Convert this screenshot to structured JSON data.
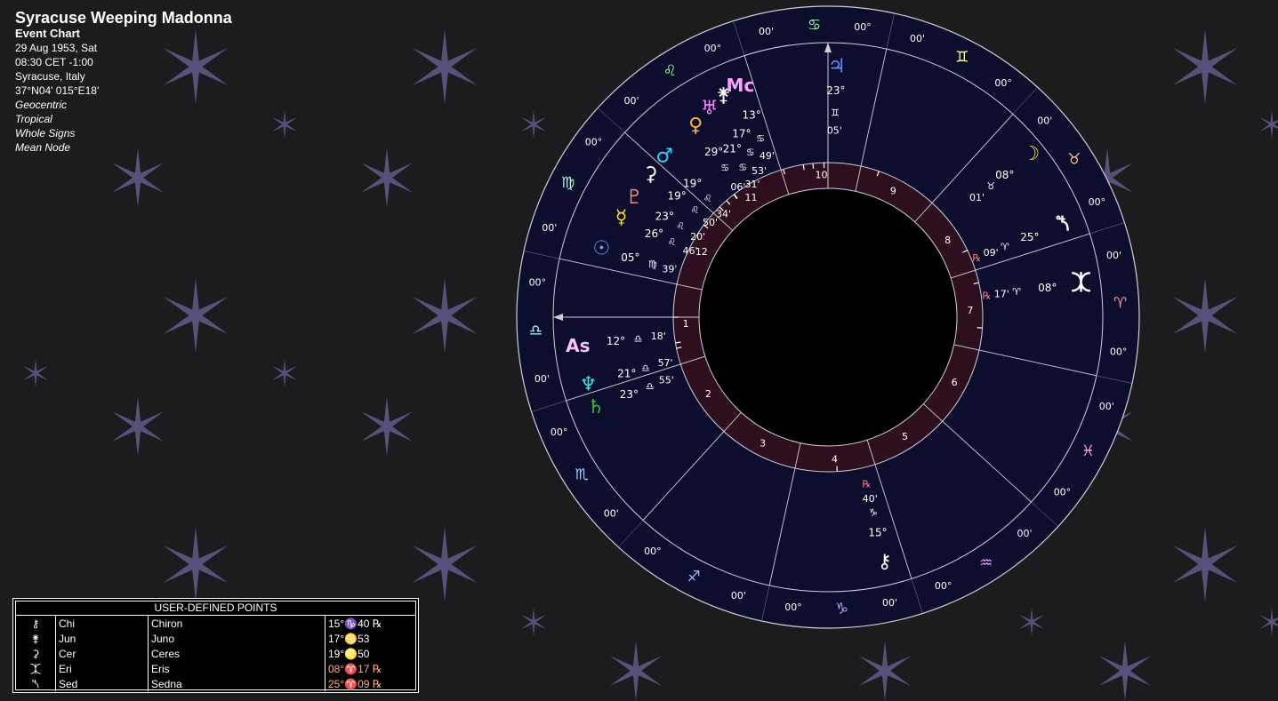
{
  "header": {
    "title": "Syracuse Weeping Madonna",
    "chart_type": "Event Chart",
    "date": "29 Aug 1953, Sat",
    "time": "08:30  CET -1:00",
    "place": "Syracuse, Italy",
    "coords": "37°N04' 015°E18'",
    "settings": [
      "Geocentric",
      "Tropical",
      "Whole Signs",
      "Mean Node"
    ]
  },
  "colors": {
    "background": "#1c1b1e",
    "star": "#5d5480",
    "wheel_bg": "#0d0d2e",
    "house_ring": "#2e0f20",
    "line": "#d0d0d8"
  },
  "zodiac": [
    {
      "sign": "aries",
      "glyph": "♈",
      "color": "#ff9a8a",
      "start": "00°",
      "end": "00'"
    },
    {
      "sign": "taurus",
      "glyph": "♉",
      "color": "#ffc090",
      "start": "00°",
      "end": "00'"
    },
    {
      "sign": "gemini",
      "glyph": "♊",
      "color": "#ffffa0",
      "start": "00°",
      "end": "00'"
    },
    {
      "sign": "cancer",
      "glyph": "♋",
      "color": "#a0ffb0",
      "start": "00°",
      "end": "00'"
    },
    {
      "sign": "leo",
      "glyph": "♌",
      "color": "#a0ffa0",
      "start": "00°",
      "end": "00'"
    },
    {
      "sign": "virgo",
      "glyph": "♍",
      "color": "#a0ffd0",
      "start": "00°",
      "end": "00'"
    },
    {
      "sign": "libra",
      "glyph": "♎",
      "color": "#a0ffff",
      "start": "00°",
      "end": "00'"
    },
    {
      "sign": "scorpio",
      "glyph": "♏",
      "color": "#a0d0ff",
      "start": "00°",
      "end": "00'"
    },
    {
      "sign": "sagittarius",
      "glyph": "♐",
      "color": "#a0b0ff",
      "start": "00°",
      "end": "00'"
    },
    {
      "sign": "capricorn",
      "glyph": "♑",
      "color": "#c0a0ff",
      "start": "00°",
      "end": "00'"
    },
    {
      "sign": "aquarius",
      "glyph": "♒",
      "color": "#e0a0ff",
      "start": "00°",
      "end": "00'"
    },
    {
      "sign": "pisces",
      "glyph": "♓",
      "color": "#ffa0e0",
      "start": "00°",
      "end": "00'"
    }
  ],
  "houses": [
    "1",
    "2",
    "3",
    "4",
    "5",
    "6",
    "7",
    "8",
    "9",
    "10",
    "11",
    "12"
  ],
  "planets": [
    {
      "name": "Mc",
      "glyph": "Mc",
      "color": "#ffa0ff",
      "deg": "13°",
      "sign": "♋",
      "min": "49'"
    },
    {
      "name": "Juno",
      "glyph": "⚵",
      "color": "#ffffff",
      "deg": "17°",
      "sign": "♋",
      "min": "53'"
    },
    {
      "name": "Uranus",
      "glyph": "♅",
      "color": "#ff80ff",
      "deg": "21°",
      "sign": "♋",
      "min": "31'"
    },
    {
      "name": "Venus",
      "glyph": "♀",
      "color": "#ffb040",
      "deg": "29°",
      "sign": "♋",
      "min": "06'"
    },
    {
      "name": "Mars",
      "glyph": "♂",
      "color": "#30d0ff",
      "deg": "19°",
      "sign": "♌",
      "min": "34'"
    },
    {
      "name": "Ceres",
      "glyph": "⚳",
      "color": "#ffffff",
      "deg": "19°",
      "sign": "♌",
      "min": "50'"
    },
    {
      "name": "Pluto",
      "glyph": "♇",
      "color": "#ff8080",
      "deg": "23°",
      "sign": "♌",
      "min": "20'"
    },
    {
      "name": "Mercury",
      "glyph": "☿",
      "color": "#ffe020",
      "deg": "26°",
      "sign": "♌",
      "min": "46'"
    },
    {
      "name": "Sun",
      "glyph": "☉",
      "color": "#60a0ff",
      "deg": "05°",
      "sign": "♍",
      "min": "39'"
    },
    {
      "name": "Asc",
      "glyph": "As",
      "color": "#ffc0ff",
      "deg": "12°",
      "sign": "♎",
      "min": "18'"
    },
    {
      "name": "Neptune",
      "glyph": "♆",
      "color": "#40e0e0",
      "deg": "21°",
      "sign": "♎",
      "min": "57'"
    },
    {
      "name": "Saturn",
      "glyph": "♄",
      "color": "#30c030",
      "deg": "23°",
      "sign": "♎",
      "min": "55'"
    },
    {
      "name": "Chiron",
      "glyph": "⚷",
      "color": "#ffffff",
      "deg": "15°",
      "sign": "♑",
      "min": "40'",
      "retro": "℞"
    },
    {
      "name": "Eris",
      "glyph": "⯰",
      "color": "#ffffff",
      "deg": "08°",
      "sign": "♈",
      "min": "17'",
      "retro": "℞"
    },
    {
      "name": "Sedna",
      "glyph": "⯲",
      "color": "#ffffff",
      "deg": "25°",
      "sign": "♈",
      "min": "09'",
      "retro": "℞"
    },
    {
      "name": "Moon",
      "glyph": "☽",
      "color": "#f0e040",
      "deg": "08°",
      "sign": "♉",
      "min": "01'"
    },
    {
      "name": "Jupiter",
      "glyph": "♃",
      "color": "#6090ff",
      "deg": "23°",
      "sign": "♊",
      "min": "05'"
    }
  ],
  "user_points": {
    "title": "USER-DEFINED POINTS",
    "rows": [
      {
        "icon": "⚷",
        "abbr": "Chi",
        "name": "Chiron",
        "pos": "15°♑40 ℞"
      },
      {
        "icon": "⚵",
        "abbr": "Jun",
        "name": "Juno",
        "pos": "17°♋53"
      },
      {
        "icon": "⚳",
        "abbr": "Cer",
        "name": "Ceres",
        "pos": "19°♌50"
      },
      {
        "icon": "⯰",
        "abbr": "Eri",
        "name": "Eris",
        "pos": "08°♈17 ℞"
      },
      {
        "icon": "⯲",
        "abbr": "Sed",
        "name": "Sedna",
        "pos": "25°♈09 ℞"
      }
    ]
  }
}
